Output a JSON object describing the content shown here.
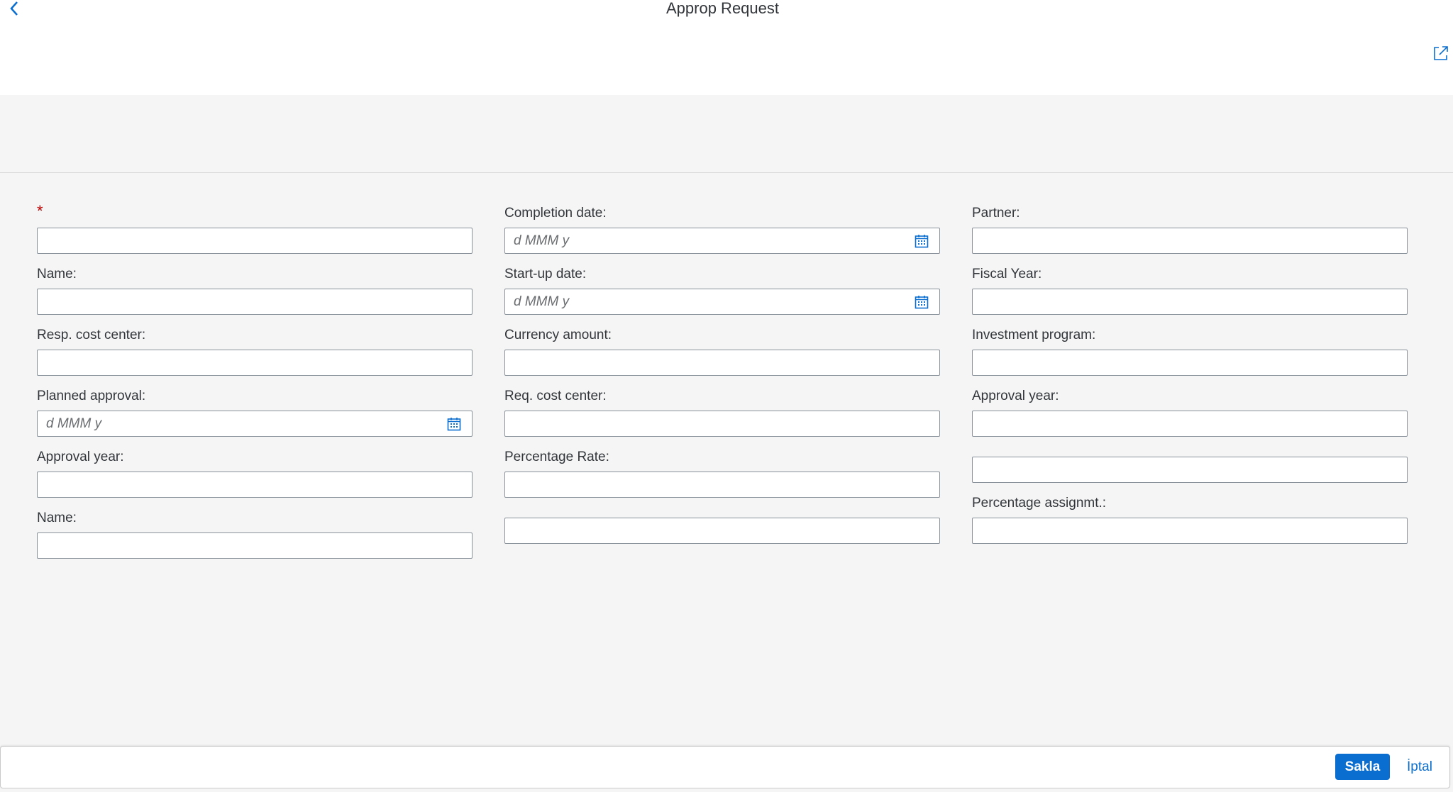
{
  "header": {
    "title": "Approp Request",
    "back_icon": "chevron-left-icon",
    "share_icon": "share-icon"
  },
  "form": {
    "date_placeholder": "d MMM y",
    "col1": {
      "field1_label": "*",
      "name_label": "Name:",
      "resp_cost_center_label": "Resp. cost center:",
      "planned_approval_label": "Planned approval:",
      "approval_year_label": "Approval year:",
      "name2_label": "Name:"
    },
    "col2": {
      "completion_date_label": "Completion date:",
      "startup_date_label": "Start-up date:",
      "currency_amount_label": "Currency amount:",
      "req_cost_center_label": "Req. cost center:",
      "percentage_rate_label": "Percentage Rate:"
    },
    "col3": {
      "partner_label": "Partner:",
      "fiscal_year_label": "Fiscal Year:",
      "investment_program_label": "Investment program:",
      "approval_year_label": "Approval year:",
      "percentage_assignmt_label": "Percentage assignmt.:"
    }
  },
  "footer": {
    "save_label": "Sakla",
    "cancel_label": "İptal"
  },
  "colors": {
    "accent": "#0a6ed1",
    "required": "#bb0000",
    "background": "#f5f5f5"
  }
}
